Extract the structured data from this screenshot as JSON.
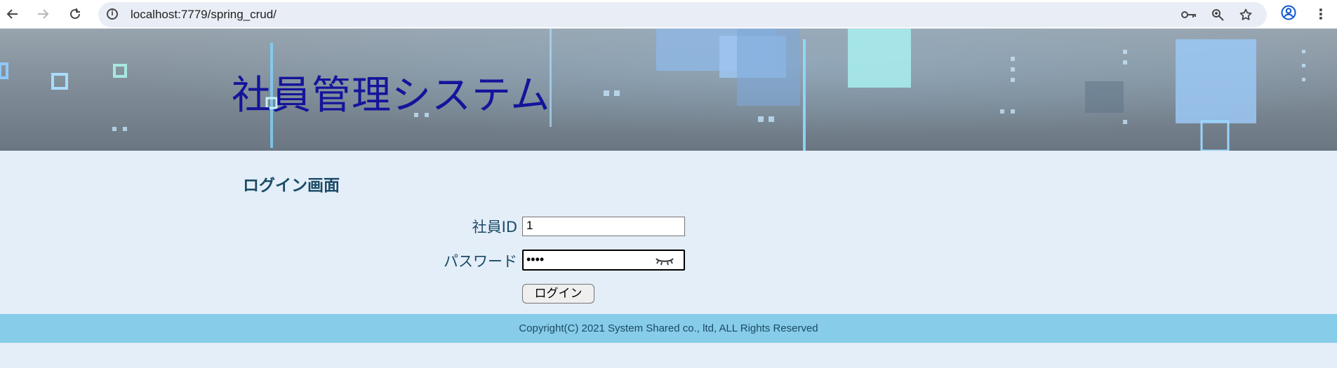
{
  "browser": {
    "url": "localhost:7779/spring_crud/",
    "icons": {
      "back": "back-arrow-icon",
      "forward": "forward-arrow-icon",
      "reload": "reload-icon",
      "site_info": "info-icon",
      "password_key": "key-icon",
      "zoom": "zoom-icon",
      "bookmark": "star-icon",
      "profile": "profile-icon",
      "menu": "kebab-menu-icon"
    }
  },
  "header": {
    "title": "社員管理システム",
    "title_color": "#14149b"
  },
  "login": {
    "heading": "ログイン画面",
    "employee_id_label": "社員ID",
    "employee_id_value": "1",
    "password_label": "パスワード",
    "password_masked": "••••",
    "submit_label": "ログイン"
  },
  "footer": {
    "copyright": "Copyright(C) 2021 System Shared co., ltd, ALL Rights Reserved",
    "background": "#87cce8"
  }
}
